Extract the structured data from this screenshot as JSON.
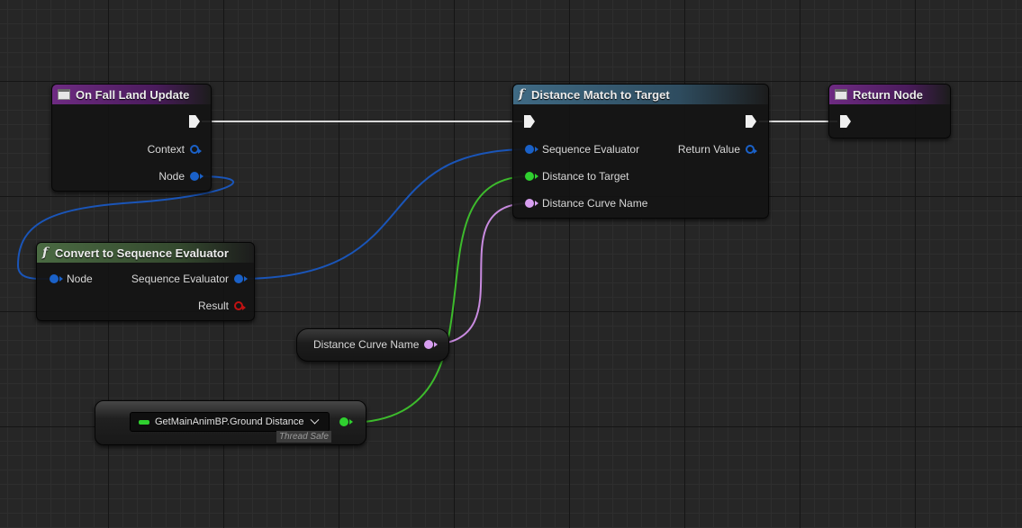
{
  "nodes": {
    "fall_land": {
      "title": "On Fall Land Update",
      "pins": {
        "context": "Context",
        "node": "Node"
      }
    },
    "distance_match": {
      "title": "Distance Match to Target",
      "pins": {
        "sequence_evaluator": "Sequence Evaluator",
        "distance_to_target": "Distance to Target",
        "distance_curve_name": "Distance Curve Name",
        "return_value": "Return Value"
      }
    },
    "return_node": {
      "title": "Return Node"
    },
    "convert": {
      "title": "Convert to Sequence Evaluator",
      "pins": {
        "node": "Node",
        "sequence_evaluator": "Sequence Evaluator",
        "result": "Result"
      }
    },
    "curve_var": {
      "label": "Distance Curve Name"
    },
    "ground_distance": {
      "value": "GetMainAnimBP.Ground Distance",
      "badge": "Thread Safe"
    }
  },
  "colors": {
    "exec": "#f0f0f0",
    "struct_pin": "#1a61c8",
    "float_pin": "#2fd02f",
    "name_pin": "#d79ef0",
    "bool_pin": "#c21212",
    "event_header": "#6e2b82",
    "pure_function_header": "#3f6a84",
    "convert_header": "#4a6a42"
  },
  "icons": {
    "event": "event-node-icon",
    "function": "function-f-icon"
  }
}
